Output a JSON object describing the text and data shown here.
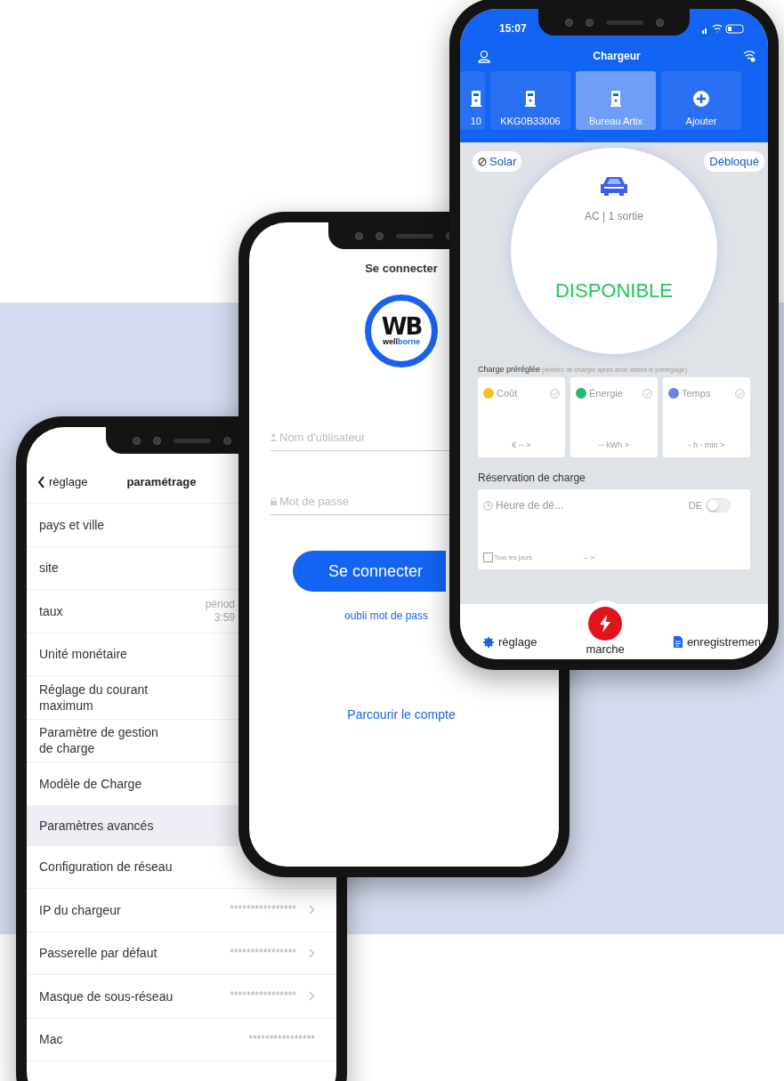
{
  "settings_phone": {
    "back": "règlage",
    "title": "paramétrage",
    "rows": [
      {
        "kind": "item",
        "label": "pays et ville"
      },
      {
        "kind": "item",
        "label": "site"
      },
      {
        "kind": "item",
        "label": "taux",
        "value_lines": [
          "périod",
          "3:59"
        ]
      },
      {
        "kind": "item",
        "label": "Unité monétaire"
      },
      {
        "kind": "item",
        "label": "Réglage du courant maximum"
      },
      {
        "kind": "item",
        "label": "Paramètre de gestion de charge"
      },
      {
        "kind": "item",
        "label": "Modèle de Charge"
      },
      {
        "kind": "section",
        "label": "Paramètres avancés"
      },
      {
        "kind": "item",
        "label": "Configuration de réseau"
      },
      {
        "kind": "item",
        "label": "IP du chargeur",
        "value_lines": [
          "****************"
        ],
        "chevron": true
      },
      {
        "kind": "item",
        "label": "Passerelle par défaut",
        "value_lines": [
          "****************"
        ],
        "chevron": true
      },
      {
        "kind": "item",
        "label": "Masque de sous-réseau",
        "value_lines": [
          "****************"
        ],
        "chevron": true
      },
      {
        "kind": "item",
        "label": "Mac",
        "value_lines": [
          "****************"
        ],
        "chevron": false
      }
    ]
  },
  "login_phone": {
    "title": "Se connecter",
    "logo": {
      "initials": "WB",
      "wordmark": [
        "well",
        "borne"
      ]
    },
    "fields": [
      {
        "kind": "user",
        "placeholder": "Nom d'utilisateur"
      },
      {
        "kind": "lock",
        "placeholder": "Mot de passe"
      }
    ],
    "submit": "Se connecter",
    "forgot_link": "oubli mot de pass",
    "browse_link": "Parcourir le compte"
  },
  "charger_phone": {
    "time": "15:07",
    "title": "Chargeur",
    "chargers": [
      {
        "kind": "charger",
        "label": "10",
        "selected": false
      },
      {
        "kind": "charger",
        "label": "KKG0B33006",
        "selected": false
      },
      {
        "kind": "charger",
        "label": "Bureau Artix",
        "selected": true
      },
      {
        "kind": "add",
        "label": "Ajouter",
        "selected": false
      }
    ],
    "mode": "Solar",
    "lock_status": "Débloqué",
    "connector": "AC | 1 sortie",
    "status": "DISPONIBLE",
    "preset": {
      "title": "Charge préréglée",
      "note": "(Arrêtez de charger après avoir atteint le préréglage)",
      "options": [
        {
          "label": "Coût",
          "color": "#f0c419",
          "value": "€ -- >"
        },
        {
          "label": "Énergie",
          "color": "#2bb673",
          "value": "-- kWh >"
        },
        {
          "label": "Temps",
          "color": "#6f7fe8",
          "value": "- h - min >"
        }
      ]
    },
    "reservation": {
      "title": "Réservation de charge",
      "start": "Heure de dé...",
      "toggle_label": "DE",
      "on": false,
      "repeat_label": "Tous les jours",
      "repeat_checked": false,
      "repeat_value": "-- >"
    },
    "nav": [
      {
        "kind": "settings",
        "label": "règlage"
      },
      {
        "kind": "start",
        "label": "marche"
      },
      {
        "kind": "records",
        "label": "enregistremen"
      }
    ]
  }
}
